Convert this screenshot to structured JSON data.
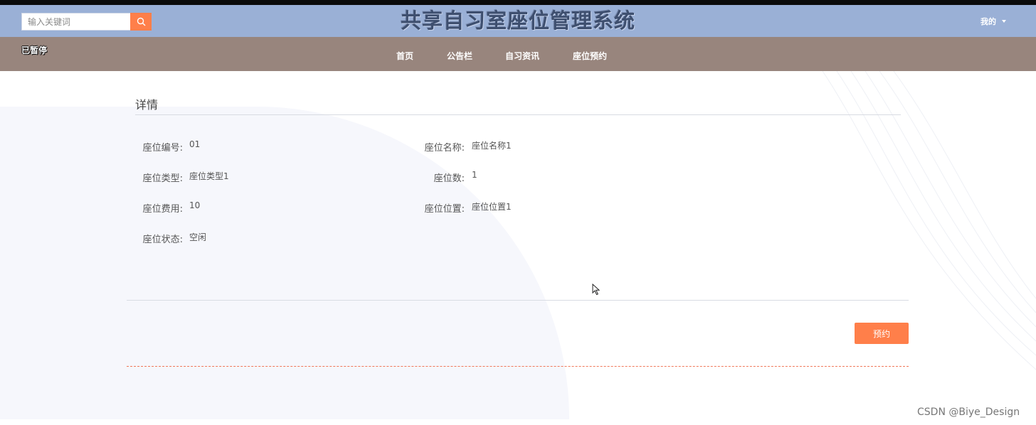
{
  "header": {
    "search_placeholder": "输入关键词",
    "site_title": "共享自习室座位管理系统",
    "user_menu": "我的"
  },
  "navbar": {
    "status": "已暂停",
    "items": [
      "首页",
      "公告栏",
      "自习资讯",
      "座位预约"
    ]
  },
  "detail": {
    "title": "详情",
    "fields": {
      "seat_no": {
        "label": "座位编号:",
        "value": "01"
      },
      "seat_name": {
        "label": "座位名称:",
        "value": "座位名称1"
      },
      "seat_type": {
        "label": "座位类型:",
        "value": "座位类型1"
      },
      "seat_count": {
        "label": "座位数:",
        "value": "1"
      },
      "seat_fee": {
        "label": "座位费用:",
        "value": "10"
      },
      "seat_location": {
        "label": "座位位置:",
        "value": "座位位置1"
      },
      "seat_status": {
        "label": "座位状态:",
        "value": "空闲"
      }
    },
    "reserve_button": "预约"
  },
  "watermark": "CSDN @Biye_Design",
  "colors": {
    "header_bg": "#9ab0d6",
    "navbar_bg": "#98857d",
    "accent": "#ff7f4a"
  }
}
